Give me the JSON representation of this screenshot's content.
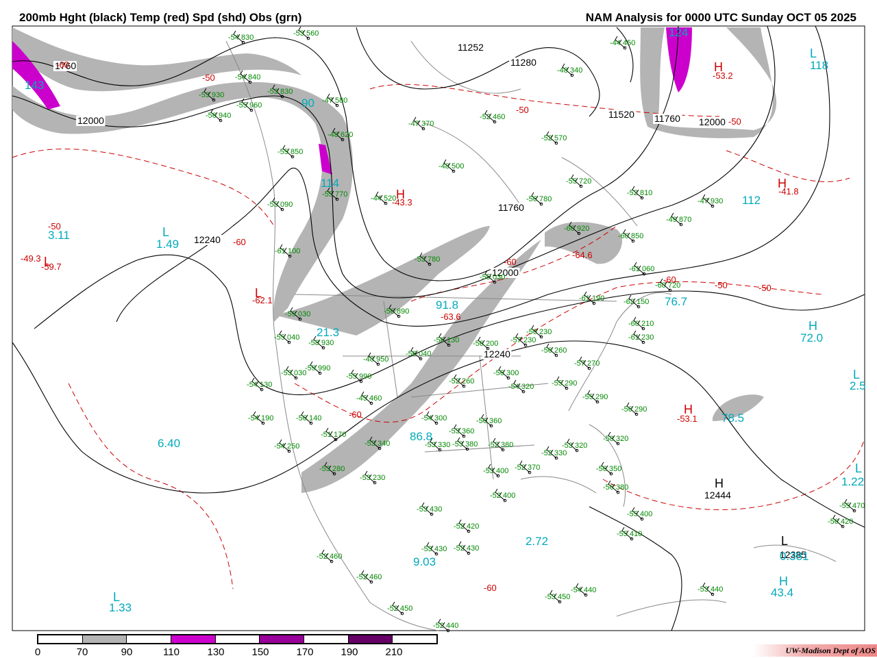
{
  "header": {
    "title_left": "200mb Hght (black) Temp (red) Spd (shd) Obs (grn)",
    "title_right": "NAM Analysis for 0000 UTC Sunday  OCT 05 2025"
  },
  "legend": {
    "colors": [
      "#ffffff",
      "#b4b4b4",
      "#ffffff",
      "#cc00cc",
      "#ffffff",
      "#990099",
      "#ffffff",
      "#660066",
      "#ffffff"
    ],
    "ticks": [
      "0",
      "70",
      "90",
      "110",
      "130",
      "150",
      "170",
      "190",
      "210"
    ]
  },
  "credit": "UW-Madison   Dept of AOS",
  "colors": {
    "height": "#000000",
    "temp": "#cc0000",
    "speed": "#00aabb",
    "obs": "#008800",
    "border": "#888888"
  },
  "height_labels": [
    "11280",
    "11520",
    "11760",
    "12000",
    "12000",
    "11760",
    "12240",
    "12000",
    "12240",
    "12444",
    "12385",
    "1760",
    "11252"
  ],
  "speed_labels": [
    "143",
    "90",
    "114",
    "112",
    "3.11",
    "1.49",
    "21.3",
    "91.8",
    "86.8",
    "6.40",
    "76.7",
    "72.0",
    "78.5",
    "2.72",
    "9.03",
    "1.33",
    "43.4",
    "1.22",
    "118",
    "124",
    "2.5",
    "0.381"
  ],
  "temp_labels": [
    "-50",
    "-50",
    "-50",
    "-41.8",
    "-53.2",
    "-60",
    "-62.1",
    "-63.6",
    "-60",
    "-64.6",
    "-60",
    "-50",
    "-50",
    "-53.1",
    "-60",
    "-43.3",
    "-49.3",
    "-59.7",
    "-50",
    "-60",
    "-60"
  ],
  "centers": [
    "H",
    "H",
    "H",
    "H",
    "L",
    "L",
    "L",
    "L",
    "L",
    "L",
    "L",
    "H",
    "H",
    "L",
    "H"
  ],
  "obs": [
    "-54 830",
    "-53 560",
    "-44 450",
    "-48 340",
    "-54 840",
    "-53 830",
    "-53 930",
    "-55 960",
    "-56 940",
    "-47 580",
    "-47 370",
    "-52 460",
    "-52 570",
    "-48 500",
    "-48 620",
    "-55 850",
    "-55 090",
    "-55 770",
    "-44 520",
    "-56 780",
    "-55 720",
    "-52 810",
    "-47 930",
    "-49 870",
    "-60 920",
    "-60 850",
    "-61 060",
    "-60 720",
    "-61 100",
    "-53 780",
    "-55 030",
    "-61 190",
    "-62 150",
    "-60 210",
    "-61 230",
    "-59 030",
    "-55 040",
    "-58 930",
    "-48 950",
    "-56 890",
    "-56 040",
    "-56 130",
    "-56 200",
    "-57 230",
    "-56 230",
    "-56 260",
    "-57 270",
    "-53 030",
    "-59 990",
    "-55 990",
    "-45 460",
    "-54 190",
    "-54 130",
    "-56 140",
    "-51 170",
    "-54 250",
    "-53 280",
    "-53 230",
    "-53 340",
    "-54 300",
    "-53 330",
    "-56 360",
    "-53 380",
    "-53 360",
    "-52 380",
    "-53 400",
    "-52 370",
    "-52 330",
    "-53 320",
    "-55 290",
    "-56 290",
    "-58 320",
    "-56 350",
    "-56 380",
    "-55 400",
    "-55 410",
    "-52 400",
    "-53 430",
    "-52 420",
    "-53 430",
    "-52 430",
    "-52 460",
    "-52 460",
    "-52 450",
    "-53 450",
    "-54 440",
    "-53 440",
    "-52 440",
    "-56 420",
    "-55 470",
    "-56 300",
    "-54 320",
    "-55 290",
    "-52 260"
  ]
}
